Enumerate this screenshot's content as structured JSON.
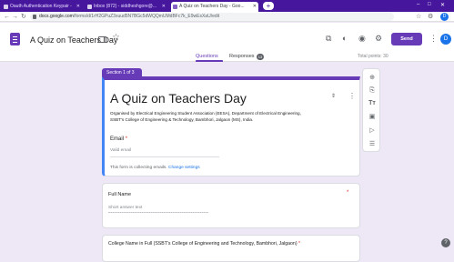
{
  "browser": {
    "tabs": [
      {
        "label": "Oauth Authentication Keypair - ",
        "active": false
      },
      {
        "label": "Inbox (872) - siddheshgore@...",
        "active": false
      },
      {
        "label": "A Quiz on Teachers Day - Goo...",
        "active": true
      }
    ],
    "url_host": "docs.google.com",
    "url_path": "/forms/d/1rH2GPuZ3xuud5N7BGc5dWQQmUMdBFc7k_E9wEsXaU/edit"
  },
  "app": {
    "doc_title": "A Quiz on Teachers Day",
    "send_label": "Send",
    "user_initial": "D",
    "accent": "#673ab7"
  },
  "tabs": {
    "questions": "Questions",
    "responses": "Responses",
    "responses_count": "13",
    "total_points": "Total points: 30"
  },
  "section": {
    "label": "Section 1 of 3"
  },
  "form": {
    "title": "A Quiz on Teachers Day",
    "description": "Organised by Electrical Engineering Student Association (EESA), Department of Electrical Engineering, SSBT's College of Engineering & Technology, Bambhori, Jalgaon (MS), India.",
    "email_label": "Email",
    "email_placeholder": "Valid email",
    "collect_note": "This form is collecting emails.",
    "collect_link": "Change settings"
  },
  "questions": [
    {
      "label": "Full Name",
      "placeholder": "Short answer text"
    },
    {
      "label": "College Name in Full (SSBT's College of Engineering and Technology, Bambhori, Jalgaon)"
    }
  ],
  "toolbar": {
    "icons": [
      "add-question-icon",
      "import-questions-icon",
      "add-title-icon",
      "add-image-icon",
      "add-video-icon",
      "add-section-icon"
    ]
  }
}
